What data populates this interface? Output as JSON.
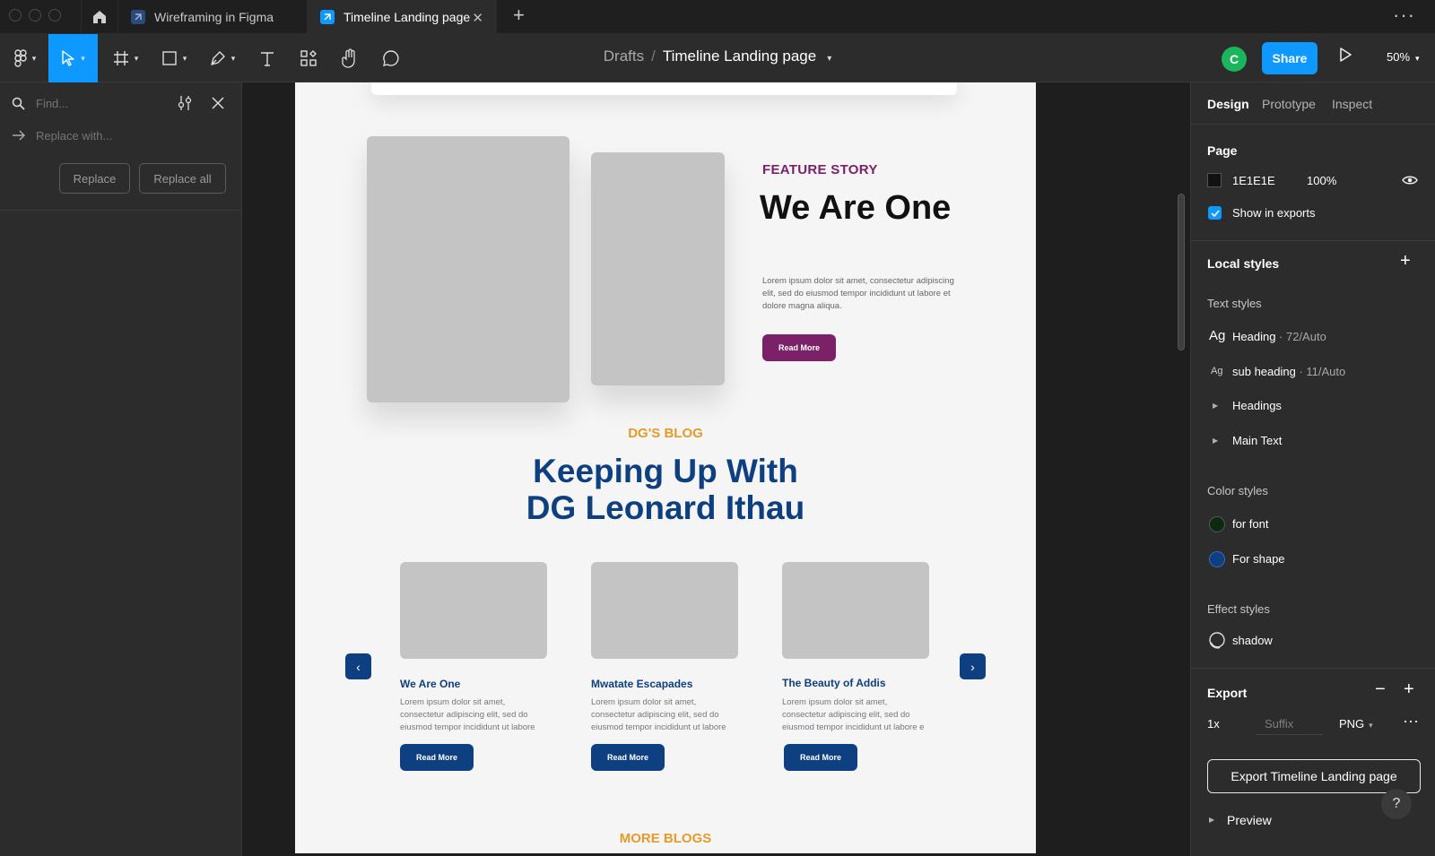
{
  "tabs": {
    "tab1_label": "Wireframing in Figma",
    "tab2_label": "Timeline Landing page"
  },
  "toolbar": {
    "crumb_root": "Drafts",
    "crumb_sep": "/",
    "file_name": "Timeline Landing page",
    "avatar_initial": "C",
    "share_label": "Share",
    "zoom_label": "50%"
  },
  "find_panel": {
    "find_placeholder": "Find...",
    "replace_placeholder": "Replace with...",
    "replace_label": "Replace",
    "replace_all_label": "Replace all"
  },
  "design_panel": {
    "tabs": [
      "Design",
      "Prototype",
      "Inspect"
    ],
    "page_heading": "Page",
    "page_color": "1E1E1E",
    "page_opacity": "100%",
    "show_in_exports": "Show in exports",
    "local_styles": "Local styles",
    "text_styles_heading": "Text styles",
    "text_styles": [
      {
        "icon": "Ag",
        "name": "Heading",
        "detail": " · 72/Auto"
      },
      {
        "icon": "Ag",
        "name": "sub heading",
        "detail": " · 11/Auto"
      }
    ],
    "groups": [
      "Headings",
      "Main Text"
    ],
    "color_styles_heading": "Color styles",
    "color_styles": [
      {
        "name": "for font",
        "color": "#0b2a10"
      },
      {
        "name": "For shape",
        "color": "#0e3f80"
      }
    ],
    "effect_styles_heading": "Effect styles",
    "effect_style": "shadow",
    "export_heading": "Export",
    "export_scale": "1x",
    "export_suffix": "Suffix",
    "export_format": "PNG",
    "export_button": "Export Timeline Landing page",
    "preview_label": "Preview",
    "help_label": "?"
  },
  "canvas": {
    "feature": {
      "eyebrow": "FEATURE STORY",
      "title": "We Are One",
      "body": "Lorem ipsum dolor sit amet, consectetur adipiscing elit, sed do eiusmod tempor incididunt ut labore et dolore magna aliqua.",
      "button": "Read More"
    },
    "blog": {
      "eyebrow": "DG'S BLOG",
      "title_line1": "Keeping Up With",
      "title_line2": "DG Leonard Ithau",
      "cards": [
        {
          "title": "We Are One",
          "body": "Lorem ipsum dolor sit amet, consectetur adipiscing elit, sed do eiusmod tempor incididunt ut labore",
          "button": "Read More"
        },
        {
          "title": "Mwatate Escapades",
          "body": "Lorem ipsum dolor sit amet, consectetur adipiscing elit, sed do eiusmod tempor incididunt ut labore",
          "button": "Read More"
        },
        {
          "title": "The Beauty of Addis",
          "body": "Lorem ipsum dolor sit amet, consectetur adipiscing elit, sed do eiusmod tempor incididunt ut labore e",
          "button": "Read More"
        }
      ]
    },
    "more_blogs": "MORE BLOGS"
  },
  "colors": {
    "accent": "#0d99ff",
    "brand_purple": "#7b2167",
    "brand_blue": "#0e3f80",
    "brand_gold": "#e39c2b"
  },
  "icons": [
    "home-icon",
    "figma-file-icon",
    "close-icon",
    "plus-icon",
    "more-icon",
    "figma-menu-icon",
    "move-icon",
    "frame-icon",
    "rectangle-icon",
    "pen-icon",
    "text-icon",
    "resources-icon",
    "hand-icon",
    "comment-icon",
    "play-icon",
    "search-icon",
    "arrow-right-icon",
    "filter-icon",
    "eye-icon",
    "checkmark-icon",
    "plus-icon",
    "minus-icon",
    "chevron-left-icon",
    "chevron-right-icon"
  ]
}
